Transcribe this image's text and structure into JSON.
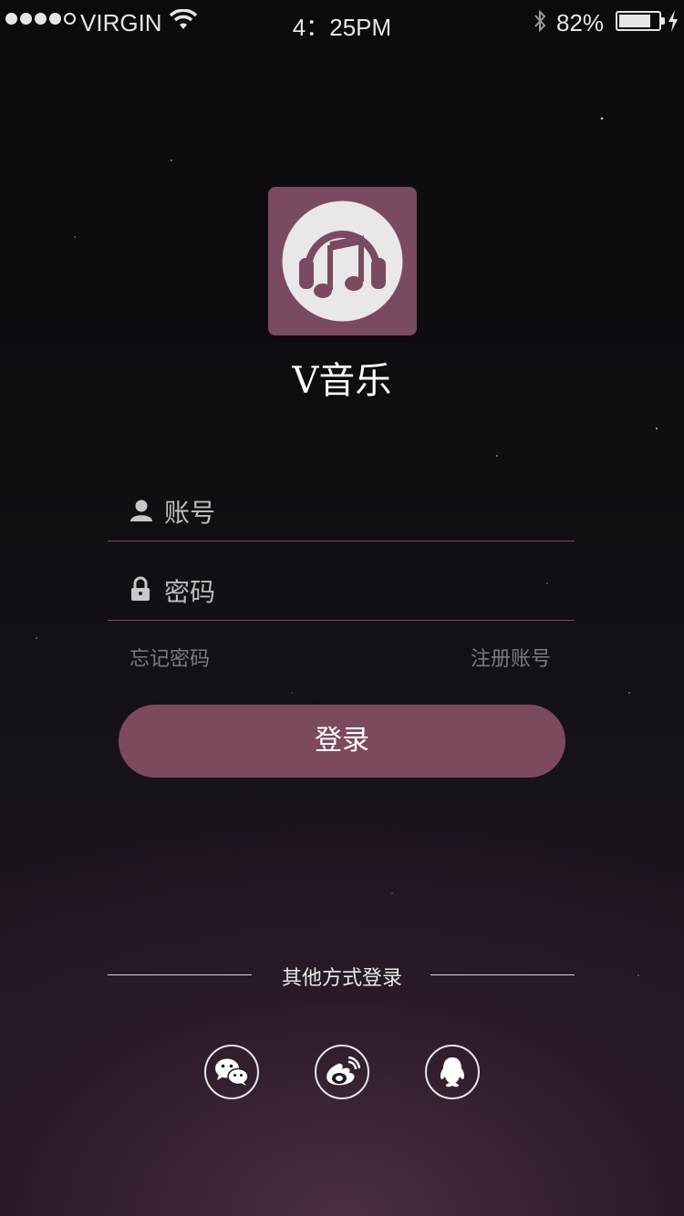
{
  "status_bar": {
    "carrier": "VIRGIN",
    "time": "4：25PM",
    "battery_percent": "82%",
    "battery_level": 0.82
  },
  "app": {
    "title": "V音乐",
    "logo_icon": "headphones-music-note-icon",
    "brand_color": "#7a4a60"
  },
  "form": {
    "account_placeholder": "账号",
    "password_placeholder": "密码",
    "forgot_password": "忘记密码",
    "register": "注册账号",
    "login_button": "登录"
  },
  "other_login": {
    "label": "其他方式登录",
    "providers": [
      "wechat-icon",
      "weibo-icon",
      "qq-icon"
    ]
  }
}
